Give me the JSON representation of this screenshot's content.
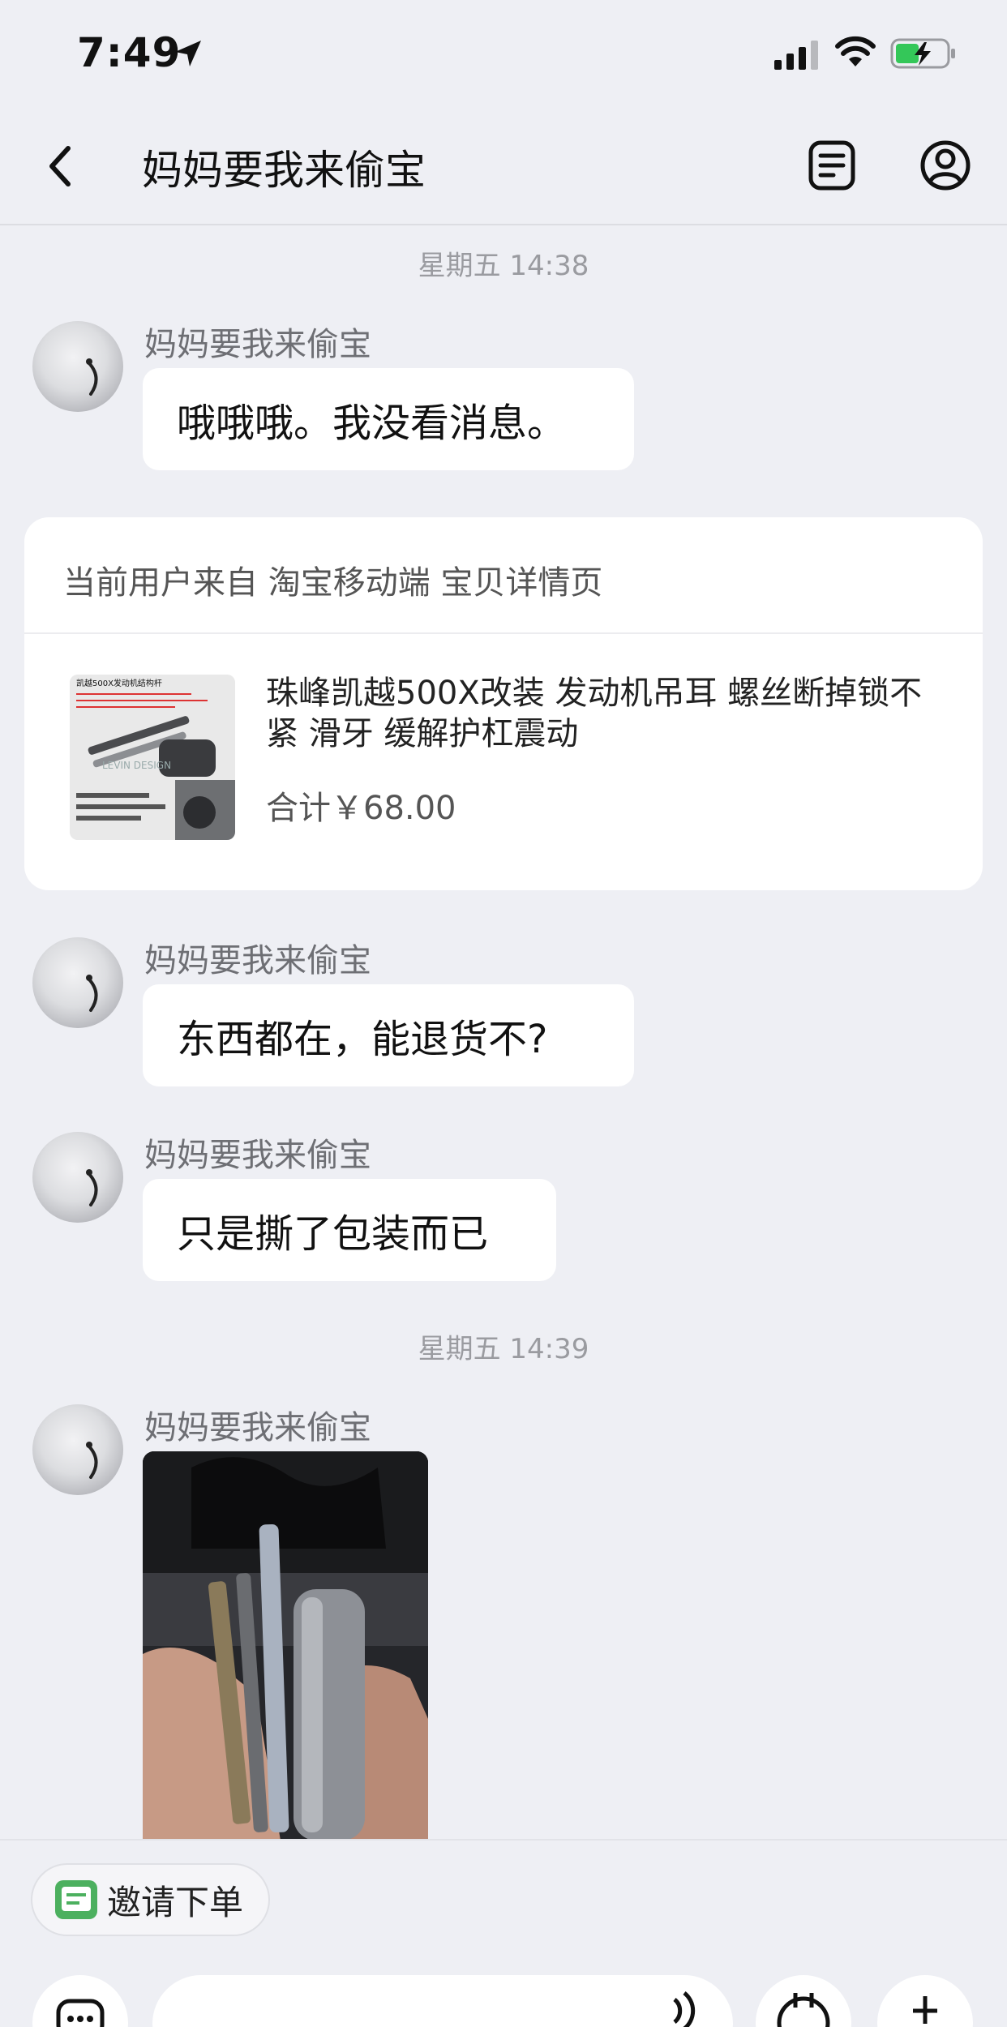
{
  "status_bar": {
    "time": "7:49"
  },
  "nav": {
    "title": "妈妈要我来偷宝"
  },
  "messages": {
    "ts1": "星期五 14:38",
    "ts2": "星期五 14:39",
    "sender": "妈妈要我来偷宝",
    "m1": "哦哦哦。我没看消息。",
    "m2": "东西都在，能退货不?",
    "m3": "只是撕了包装而已"
  },
  "product_card": {
    "source": "当前用户来自 淘宝移动端 宝贝详情页",
    "title": "珠峰凯越500X改装 发动机吊耳 螺丝断掉锁不紧 滑牙 缓解护杠震动",
    "price": "合计￥68.00",
    "thumb_caption": "凯越500X发动机结构杆",
    "thumb_logo": "LEVIN DESIGN"
  },
  "bottom": {
    "invite_label": "邀请下单"
  },
  "colors": {
    "background": "#eeeff4",
    "bubble": "#ffffff",
    "timestamp": "#9a9ba0",
    "invite_icon": "#4cb05f"
  }
}
